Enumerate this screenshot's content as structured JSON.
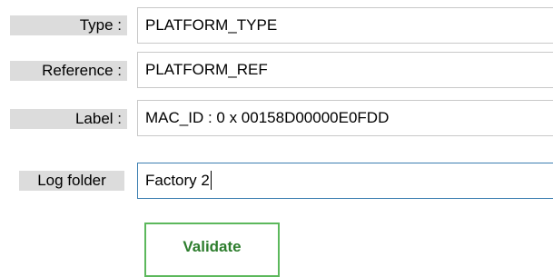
{
  "form": {
    "type": {
      "label": "Type :",
      "value": "PLATFORM_TYPE"
    },
    "reference": {
      "label": "Reference :",
      "value": "PLATFORM_REF"
    },
    "label_field": {
      "label": "Label :",
      "value": "MAC_ID : 0 x 00158D00000E0FDD"
    },
    "log_folder": {
      "label": "Log folder",
      "value": "Factory 2"
    }
  },
  "actions": {
    "validate_label": "Validate"
  },
  "colors": {
    "label_background": "#dcdcdc",
    "field_border": "#c8c8c8",
    "focused_border": "#3c7fb1",
    "validate_border": "#5cb85c",
    "validate_text": "#2d7d2d"
  }
}
